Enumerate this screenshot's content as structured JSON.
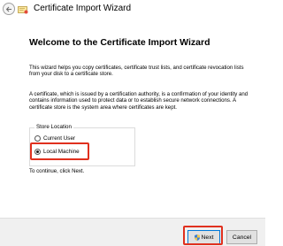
{
  "window": {
    "title": "Certificate Import Wizard"
  },
  "wizard": {
    "heading": "Welcome to the Certificate Import Wizard",
    "intro": "This wizard helps you copy certificates, certificate trust lists, and certificate revocation lists from your disk to a certificate store.",
    "description": "A certificate, which is issued by a certification authority, is a confirmation of your identity and contains information used to protect data or to establish secure network connections. A certificate store is the system area where certificates are kept.",
    "store_location": {
      "legend": "Store Location",
      "options": [
        {
          "label": "Current User",
          "selected": false
        },
        {
          "label": "Local Machine",
          "selected": true
        }
      ]
    },
    "continue_text": "To continue, click Next."
  },
  "footer": {
    "next_label": "Next",
    "cancel_label": "Cancel"
  },
  "colors": {
    "highlight": "#e0301e",
    "footer_bg": "#f0f0f0",
    "focus_border": "#0078d7"
  },
  "icons": {
    "back": "back-arrow-icon",
    "app": "certificate-icon",
    "shield": "uac-shield-icon"
  }
}
